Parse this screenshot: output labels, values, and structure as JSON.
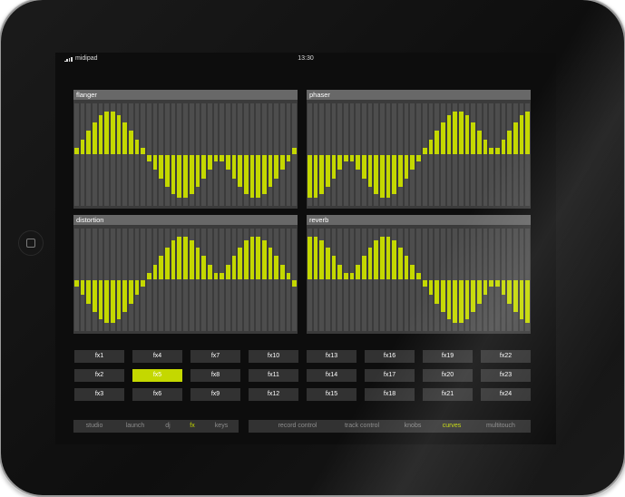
{
  "status": {
    "carrier": "midipad",
    "time": "13:30"
  },
  "panels": [
    {
      "label": "flanger",
      "values": [
        0.13,
        0.29,
        0.47,
        0.64,
        0.77,
        0.85,
        0.85,
        0.77,
        0.64,
        0.47,
        0.29,
        0.13,
        -0.13,
        -0.29,
        -0.47,
        -0.64,
        -0.77,
        -0.85,
        -0.85,
        -0.77,
        -0.64,
        -0.47,
        -0.29,
        -0.13,
        -0.13,
        -0.29,
        -0.47,
        -0.64,
        -0.77,
        -0.85,
        -0.85,
        -0.77,
        -0.64,
        -0.47,
        -0.29,
        -0.13,
        0.13
      ]
    },
    {
      "label": "phaser",
      "values": [
        -0.85,
        -0.85,
        -0.77,
        -0.64,
        -0.47,
        -0.29,
        -0.13,
        -0.13,
        -0.29,
        -0.47,
        -0.64,
        -0.77,
        -0.85,
        -0.85,
        -0.77,
        -0.64,
        -0.47,
        -0.29,
        -0.13,
        0.13,
        0.29,
        0.47,
        0.64,
        0.77,
        0.85,
        0.85,
        0.77,
        0.64,
        0.47,
        0.29,
        0.13,
        0.13,
        0.29,
        0.47,
        0.64,
        0.77,
        0.85
      ]
    },
    {
      "label": "distortion",
      "values": [
        -0.13,
        -0.29,
        -0.47,
        -0.64,
        -0.77,
        -0.85,
        -0.85,
        -0.77,
        -0.64,
        -0.47,
        -0.29,
        -0.13,
        0.13,
        0.29,
        0.47,
        0.64,
        0.77,
        0.85,
        0.85,
        0.77,
        0.64,
        0.47,
        0.29,
        0.13,
        0.13,
        0.29,
        0.47,
        0.64,
        0.77,
        0.85,
        0.85,
        0.77,
        0.64,
        0.47,
        0.29,
        0.13,
        -0.13
      ]
    },
    {
      "label": "reverb",
      "values": [
        0.85,
        0.85,
        0.77,
        0.64,
        0.47,
        0.29,
        0.13,
        0.13,
        0.29,
        0.47,
        0.64,
        0.77,
        0.85,
        0.85,
        0.77,
        0.64,
        0.47,
        0.29,
        0.13,
        -0.13,
        -0.29,
        -0.47,
        -0.64,
        -0.77,
        -0.85,
        -0.85,
        -0.77,
        -0.64,
        -0.47,
        -0.29,
        -0.13,
        -0.13,
        -0.29,
        -0.47,
        -0.64,
        -0.77,
        -0.85
      ]
    }
  ],
  "fx_buttons": [
    [
      "fx1",
      "fx4",
      "fx7",
      "fx10",
      "fx13",
      "fx16",
      "fx19",
      "fx22"
    ],
    [
      "fx2",
      "fx5",
      "fx8",
      "fx11",
      "fx14",
      "fx17",
      "fx20",
      "fx23"
    ],
    [
      "fx3",
      "fx6",
      "fx9",
      "fx12",
      "fx15",
      "fx18",
      "fx21",
      "fx24"
    ]
  ],
  "fx_active": "fx5",
  "nav": {
    "left": [
      {
        "label": "studio"
      },
      {
        "label": "launch"
      },
      {
        "label": "dj"
      },
      {
        "label": "fx",
        "active": true
      },
      {
        "label": "keys"
      }
    ],
    "right": [
      {
        "label": "record control"
      },
      {
        "label": "track control"
      },
      {
        "label": "knobs"
      },
      {
        "label": "curves",
        "active": true
      },
      {
        "label": "multitouch"
      }
    ]
  },
  "colors": {
    "accent": "#c4d800",
    "panel_header": "#686868",
    "bar_track": "#4d4d4d",
    "button": "#323232"
  }
}
